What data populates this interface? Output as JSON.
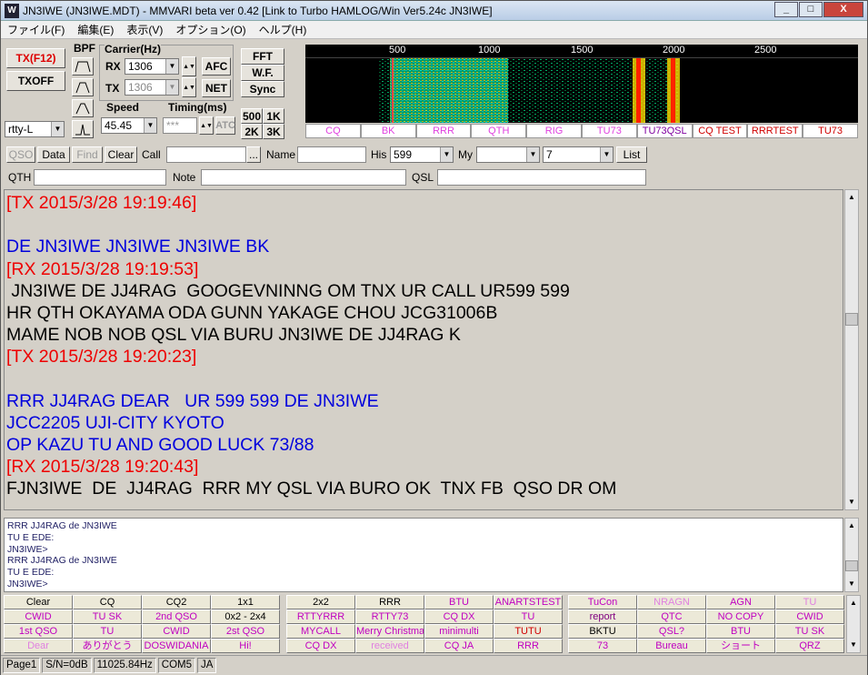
{
  "title": "JN3IWE (JN3IWE.MDT) - MMVARI beta ver 0.42 [Link to Turbo HAMLOG/Win Ver5.24c JN3IWE]",
  "menu": [
    "ファイル(F)",
    "編集(E)",
    "表示(V)",
    "オプション(O)",
    "ヘルプ(H)"
  ],
  "window": {
    "minimize": "_",
    "maximize": "□",
    "close": "X"
  },
  "left": {
    "tx": "TX(F12)",
    "txoff": "TXOFF",
    "mode": "rtty-L",
    "bpf": "BPF"
  },
  "carrier": {
    "label": "Carrier(Hz)",
    "rx_label": "RX",
    "rx": "1306",
    "tx_label": "TX",
    "tx": "1306",
    "afc": "AFC",
    "net": "NET"
  },
  "speed": {
    "label": "Speed",
    "value": "45.45"
  },
  "timing": {
    "label": "Timing(ms)",
    "value": "***",
    "atc": "ATC"
  },
  "view": {
    "fft": "FFT",
    "wf": "W.F.",
    "sync": "Sync",
    "b500": "500",
    "b1k": "1K",
    "b2k": "2K",
    "b3k": "3K"
  },
  "scale": [
    "500",
    "1000",
    "1500",
    "2000",
    "2500"
  ],
  "spec_macros": [
    "CQ",
    "BK",
    "RRR",
    "QTH",
    "RIG",
    "TU73",
    "TU73QSL",
    "CQ TEST",
    "RRRTEST",
    "TU73"
  ],
  "spec_colors": [
    "#e040e0",
    "#e040e0",
    "#e040e0",
    "#e040e0",
    "#e040e0",
    "#e040e0",
    "#8000a0",
    "#d00000",
    "#d00000",
    "#d00000"
  ],
  "log": {
    "qso": "QSO",
    "data": "Data",
    "find": "Find",
    "clear": "Clear",
    "call": "Call",
    "dots": "...",
    "name": "Name",
    "his": "His",
    "his_val": "599",
    "my": "My",
    "my_val": "",
    "seven": "7",
    "list": "List",
    "qth": "QTH",
    "note": "Note",
    "qsl": "QSL"
  },
  "rx_lines": [
    {
      "t": "[TX 2015/3/28 19:19:46]",
      "c": "red"
    },
    {
      "t": "",
      "c": "blk"
    },
    {
      "t": "DE JN3IWE JN3IWE JN3IWE BK",
      "c": "blue"
    },
    {
      "t": "[RX 2015/3/28 19:19:53]",
      "c": "red"
    },
    {
      "t": " JN3IWE DE JJ4RAG  GOOGEVNINNG OM TNX UR CALL UR599 599",
      "c": "blk"
    },
    {
      "t": "HR QTH OKAYAMA ODA GUNN YAKAGE CHOU JCG31006B",
      "c": "blk"
    },
    {
      "t": "MAME NOB NOB QSL VIA BURU JN3IWE DE JJ4RAG K",
      "c": "blk"
    },
    {
      "t": "[TX 2015/3/28 19:20:23]",
      "c": "red"
    },
    {
      "t": "",
      "c": "blk"
    },
    {
      "t": "RRR JJ4RAG DEAR   UR 599 599 DE JN3IWE",
      "c": "blue"
    },
    {
      "t": "JCC2205 UJI-CITY KYOTO",
      "c": "blue"
    },
    {
      "t": "OP KAZU TU AND GOOD LUCK 73/88",
      "c": "blue"
    },
    {
      "t": "[RX 2015/3/28 19:20:43]",
      "c": "red"
    },
    {
      "t": "FJN3IWE  DE  JJ4RAG  RRR MY QSL VIA BURO OK  TNX FB  QSO DR OM",
      "c": "blk"
    }
  ],
  "tx_lines": [
    "RRR JJ4RAG de JN3IWE",
    "TU E EDE:",
    "JN3IWE>",
    "RRR JJ4RAG de JN3IWE",
    "TU E EDE:",
    "JN3IWE>"
  ],
  "macros1": [
    {
      "l": "Clear",
      "c": "#000"
    },
    {
      "l": "CQ",
      "c": "#000"
    },
    {
      "l": "CQ2",
      "c": "#000"
    },
    {
      "l": "1x1",
      "c": "#000"
    },
    {
      "l": "CWID",
      "c": "#c000c0"
    },
    {
      "l": "TU SK",
      "c": "#c000c0"
    },
    {
      "l": "2nd QSO",
      "c": "#c000c0"
    },
    {
      "l": "0x2 - 2x4",
      "c": "#000"
    },
    {
      "l": "1st QSO",
      "c": "#c000c0"
    },
    {
      "l": "TU",
      "c": "#c000c0"
    },
    {
      "l": "CWID",
      "c": "#c000c0"
    },
    {
      "l": "2st QSO",
      "c": "#c000c0"
    },
    {
      "l": "Dear",
      "c": "#e080e0"
    },
    {
      "l": "ありがとう",
      "c": "#c000c0"
    },
    {
      "l": "DOSWIDANIA",
      "c": "#c000c0"
    },
    {
      "l": "Hi!",
      "c": "#c000c0"
    }
  ],
  "macros2": [
    {
      "l": "2x2",
      "c": "#000"
    },
    {
      "l": "RRR",
      "c": "#000"
    },
    {
      "l": "BTU",
      "c": "#c000c0"
    },
    {
      "l": "ANARTSTEST",
      "c": "#c000c0"
    },
    {
      "l": "RTTYRRR",
      "c": "#c000c0"
    },
    {
      "l": "RTTY73",
      "c": "#c000c0"
    },
    {
      "l": "CQ DX",
      "c": "#c000c0"
    },
    {
      "l": "TU",
      "c": "#c000c0"
    },
    {
      "l": "MYCALL",
      "c": "#c000c0"
    },
    {
      "l": "Merry Christmas",
      "c": "#c000c0"
    },
    {
      "l": "minimulti",
      "c": "#c000c0"
    },
    {
      "l": "TUTU",
      "c": "#d00000"
    },
    {
      "l": "CQ DX",
      "c": "#c000c0"
    },
    {
      "l": "received",
      "c": "#e080e0"
    },
    {
      "l": "CQ JA",
      "c": "#c000c0"
    },
    {
      "l": "RRR",
      "c": "#c000c0"
    }
  ],
  "macros3": [
    {
      "l": "TuCon",
      "c": "#c000c0"
    },
    {
      "l": "NRAGN",
      "c": "#e080e0"
    },
    {
      "l": "AGN",
      "c": "#c000c0"
    },
    {
      "l": "TU",
      "c": "#e080e0"
    },
    {
      "l": "report",
      "c": "#800080"
    },
    {
      "l": "QTC",
      "c": "#c000c0"
    },
    {
      "l": "NO COPY",
      "c": "#c000c0"
    },
    {
      "l": "CWID",
      "c": "#c000c0"
    },
    {
      "l": "BKTU",
      "c": "#000"
    },
    {
      "l": "QSL?",
      "c": "#c000c0"
    },
    {
      "l": "BTU",
      "c": "#c000c0"
    },
    {
      "l": "TU SK",
      "c": "#c000c0"
    },
    {
      "l": "73",
      "c": "#c000c0"
    },
    {
      "l": "Bureau",
      "c": "#c000c0"
    },
    {
      "l": "ショート",
      "c": "#c000c0"
    },
    {
      "l": "QRZ",
      "c": "#c000c0"
    }
  ],
  "status": [
    "Page1",
    "S/N=0dB",
    "11025.84Hz",
    "COM5",
    "JA"
  ]
}
